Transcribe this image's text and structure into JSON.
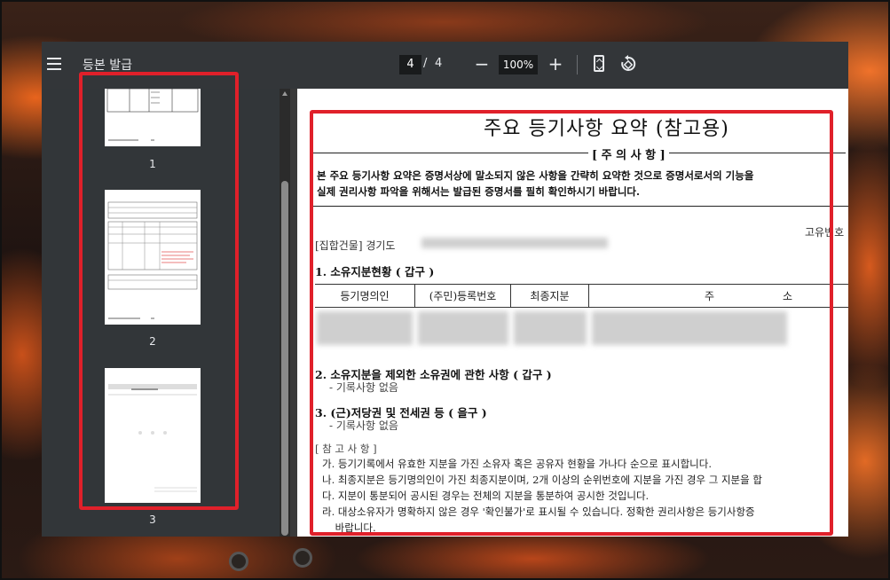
{
  "toolbar": {
    "title": "등본 발급",
    "current_page": "4",
    "page_separator": "/",
    "total_pages": "4",
    "zoom_out": "−",
    "zoom_level": "100%",
    "zoom_in": "+"
  },
  "sidebar": {
    "thumbnails": [
      {
        "label": "1"
      },
      {
        "label": "2"
      },
      {
        "label": "3"
      }
    ]
  },
  "document": {
    "title": "주요 등기사항 요약 (참고용)",
    "warning_header": "[ 주 의 사 항 ]",
    "warning_line1": "본 주요 등기사항 요약은 증명서상에 말소되지 않은 사항을 간략히 요약한 것으로 증명서로서의 기능을",
    "warning_line2": "실제 권리사항 파악을 위해서는 발급된 증명서를 필히 확인하시기 바랍니다.",
    "unique_number_label": "고유번호",
    "building_label": "[집합건물] 경기도",
    "section1": "1. 소유지분현황 ( 갑구 )",
    "table_headers": [
      "등기명의인",
      "(주민)등록번호",
      "최종지분",
      "주",
      "소"
    ],
    "section2": "2. 소유지분을 제외한 소유권에 관한 사항 ( 갑구 )",
    "section2_note": "- 기록사항 없음",
    "section3": "3. (근)저당권 및 전세권 등 ( 을구 )",
    "section3_note": "- 기록사항 없음",
    "reference_header": "[ 참 고 사 항 ]",
    "references": [
      "가. 등기기록에서 유효한 지분을 가진 소유자 혹은 공유자 현황을 가나다 순으로 표시합니다.",
      "나. 최종지분은 등기명의인이 가진 최종지분이며, 2개 이상의 순위번호에 지분을 가진 경우 그 지분을 합",
      "다. 지분이 통분되어 공시된 경우는 전체의 지분을 통분하여 공시한 것입니다.",
      "라. 대상소유자가 명확하지 않은 경우 '확인불가'로 표시될 수 있습니다. 정확한 권리사항은 등기사항증",
      "    바랍니다."
    ]
  },
  "colors": {
    "highlight": "#e0202a",
    "toolbar_bg": "#333639",
    "sidebar_bg": "#323639"
  }
}
